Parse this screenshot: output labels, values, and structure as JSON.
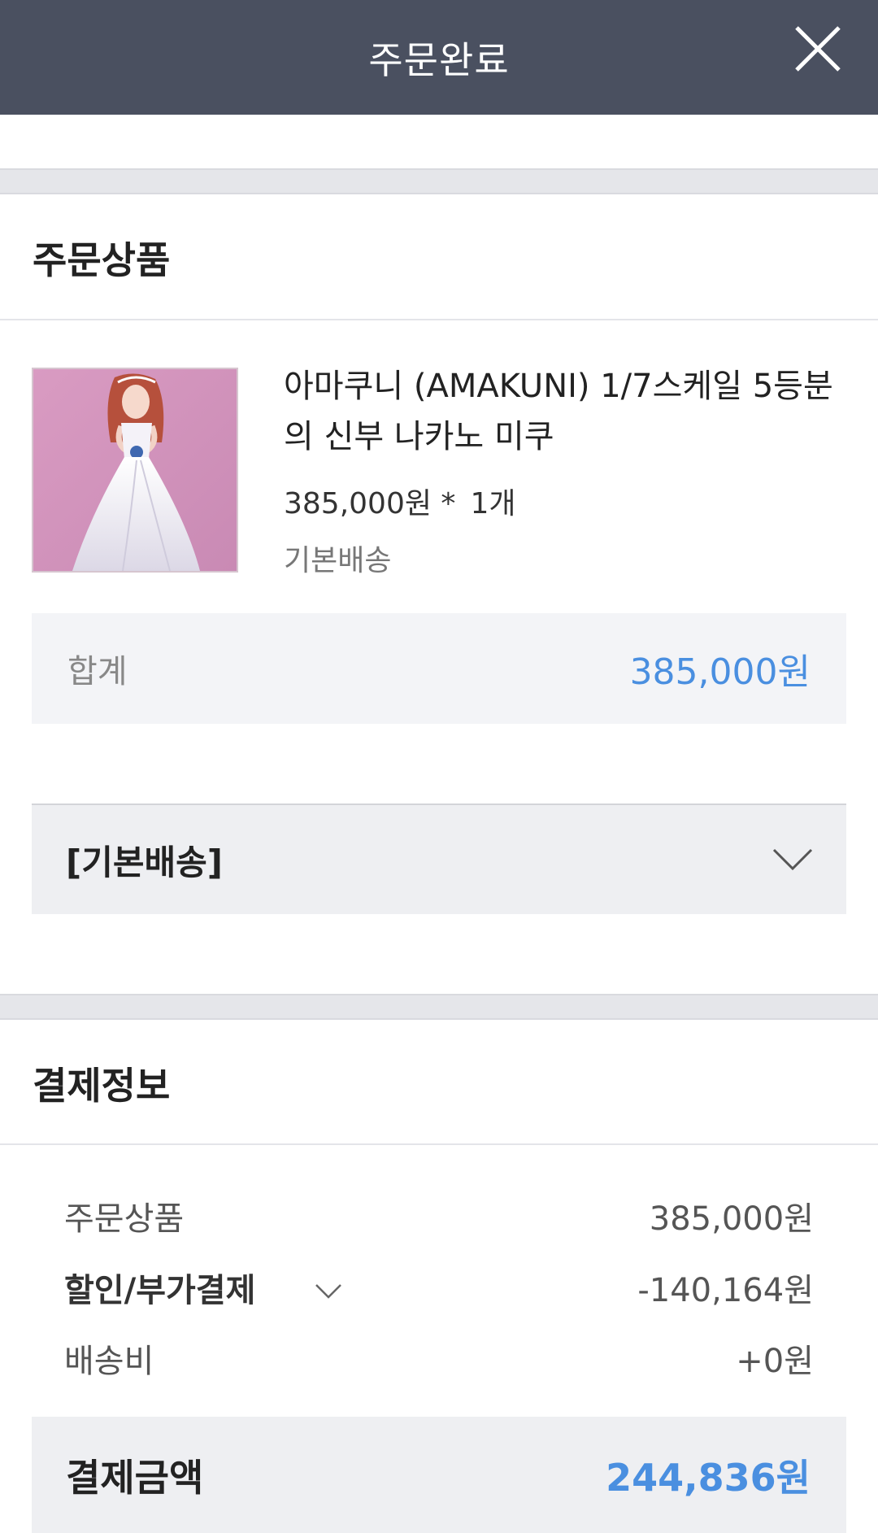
{
  "header": {
    "title": "주문완료",
    "close_icon": "close-icon"
  },
  "order_section": {
    "title": "주문상품",
    "product": {
      "name": "아마쿠니 (AMAKUNI) 1/7스케일 5등분의 신부 나카노 미쿠",
      "price": "385,000원 *",
      "quantity": "1개",
      "shipping_type": "기본배송",
      "image_icon": "figure-product-image"
    },
    "total": {
      "label": "합계",
      "value": "385,000원"
    },
    "shipping_group": {
      "label": "[기본배송]",
      "icon": "chevron-down-icon"
    }
  },
  "payment_section": {
    "title": "결제정보",
    "rows": [
      {
        "label": "주문상품",
        "value": "385,000원"
      },
      {
        "label": "할인/부가결제",
        "value": "-140,164원"
      },
      {
        "label": "배송비",
        "value": "+0원"
      }
    ],
    "final": {
      "label": "결제금액",
      "value": "244,836원"
    }
  },
  "colors": {
    "header_bg": "#4a5060",
    "accent_blue": "#4a8fe0",
    "band": "#e5e6ea"
  }
}
